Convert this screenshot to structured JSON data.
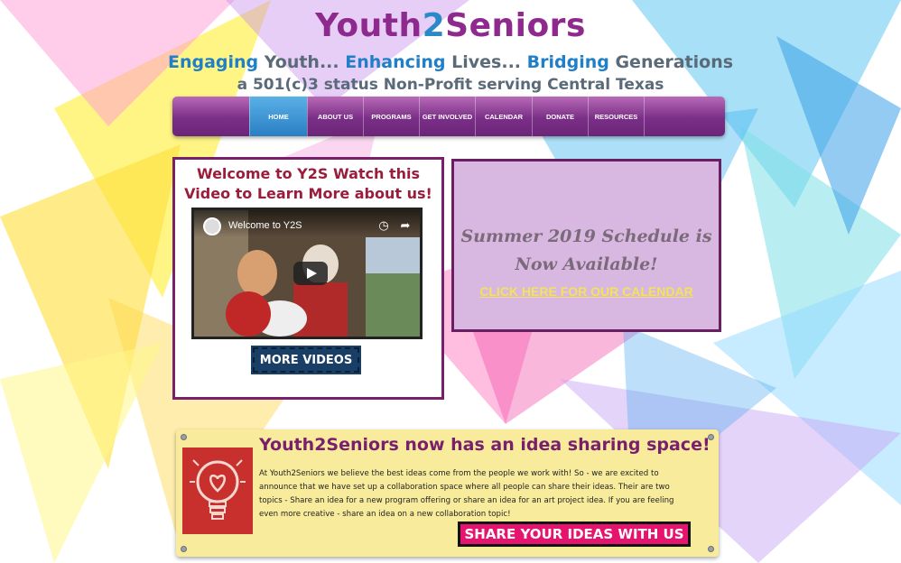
{
  "header": {
    "title_part1": "Youth",
    "title_part2": "2",
    "title_part3": "Seniors",
    "tagline": {
      "w1": "Engaging",
      "w2": " Youth... ",
      "w3": "Enhancing",
      "w4": " Lives... ",
      "w5": "Bridging",
      "w6": " Generations"
    },
    "subtagline": "a 501(c)3 status Non-Profit serving Central Texas"
  },
  "nav": {
    "items": [
      {
        "label": "HOME",
        "active": true
      },
      {
        "label": "ABOUT US"
      },
      {
        "label": "PROGRAMS"
      },
      {
        "label": "GET INVOLVED"
      },
      {
        "label": "CALENDAR"
      },
      {
        "label": "DONATE"
      },
      {
        "label": "RESOURCES"
      }
    ]
  },
  "video_section": {
    "heading": "Welcome to Y2S Watch this Video to Learn More about us!",
    "video_title": "Welcome to Y2S",
    "more_videos_label": "MORE VIDEOS"
  },
  "schedule": {
    "text": "Summer 2019 Schedule is Now Available!",
    "link_label": "CLICK HERE FOR OUR CALENDAR"
  },
  "ideas": {
    "heading": "Youth2Seniors now has an idea sharing space!",
    "body": "At Youth2Seniors we believe the best ideas come from the people we work with! So - we are excited to announce that we have set up a collaboration space where all people can share their ideas. Their are two topics - Share an idea for a new program offering or share an idea for an art project idea. If you are feeling even more creative - share an idea on a new collaboration topic!",
    "button_label": "SHARE YOUR IDEAS WITH US"
  },
  "colors": {
    "brand_purple": "#8e2a8e",
    "nav_active": "#2a7ec4",
    "share_button": "#e5146f",
    "panel_yellow": "#f8ec9c"
  }
}
